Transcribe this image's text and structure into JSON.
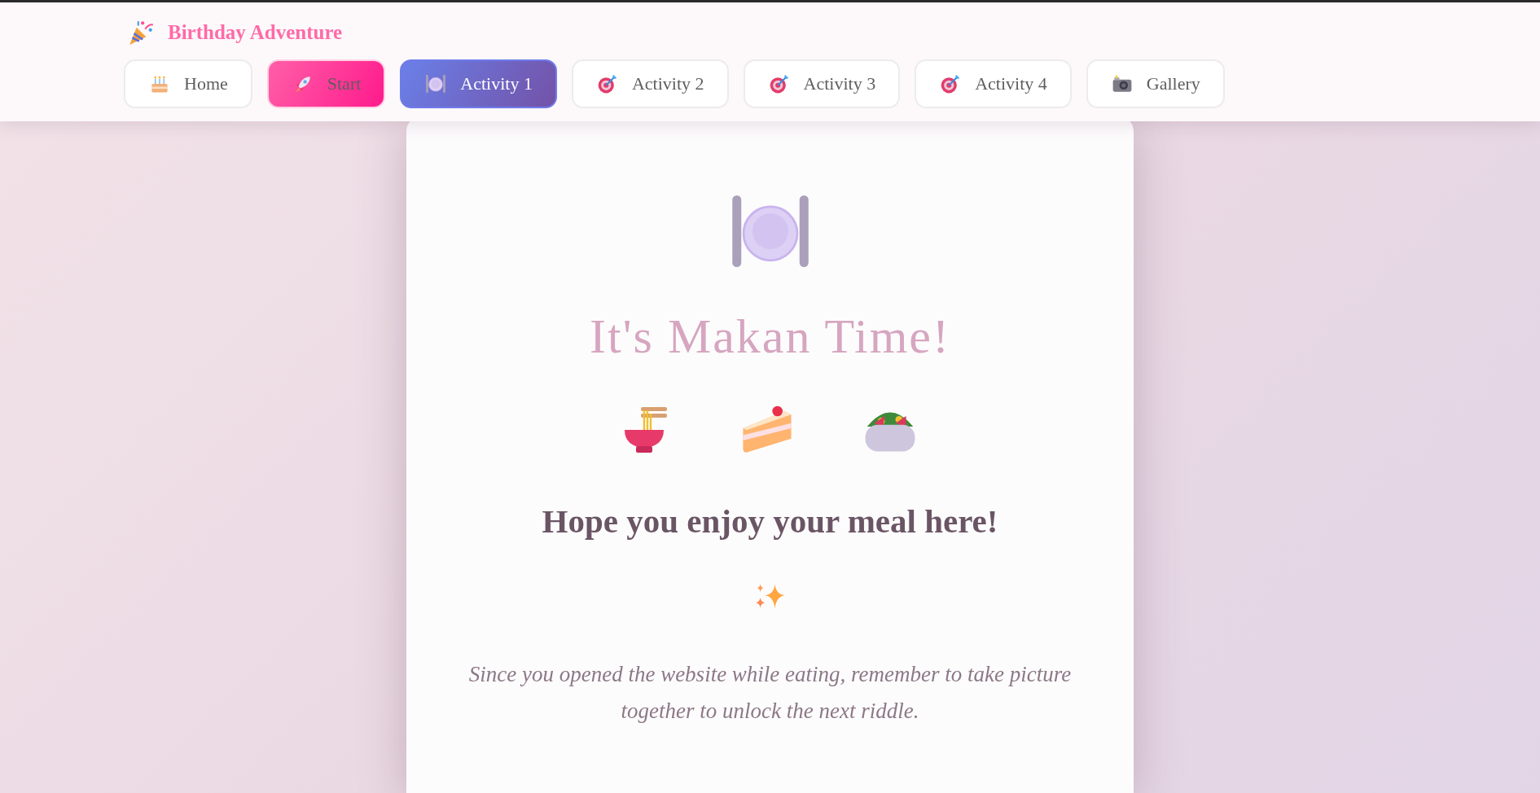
{
  "header": {
    "brand": "Birthday Adventure",
    "nav": [
      {
        "label": "Home",
        "kind": "plain",
        "selected": false
      },
      {
        "label": "Start",
        "kind": "accent",
        "selected": false
      },
      {
        "label": "Activity 1",
        "kind": "plain",
        "selected": true
      },
      {
        "label": "Activity 2",
        "kind": "plain",
        "selected": false
      },
      {
        "label": "Activity 3",
        "kind": "plain",
        "selected": false
      },
      {
        "label": "Activity 4",
        "kind": "plain",
        "selected": false
      },
      {
        "label": "Gallery",
        "kind": "plain",
        "selected": false
      }
    ]
  },
  "card": {
    "title": "It's Makan Time!",
    "heading": "Hope you enjoy your meal here!",
    "message": "Since you opened the website while eating, remember to take picture together to unlock the next riddle."
  }
}
